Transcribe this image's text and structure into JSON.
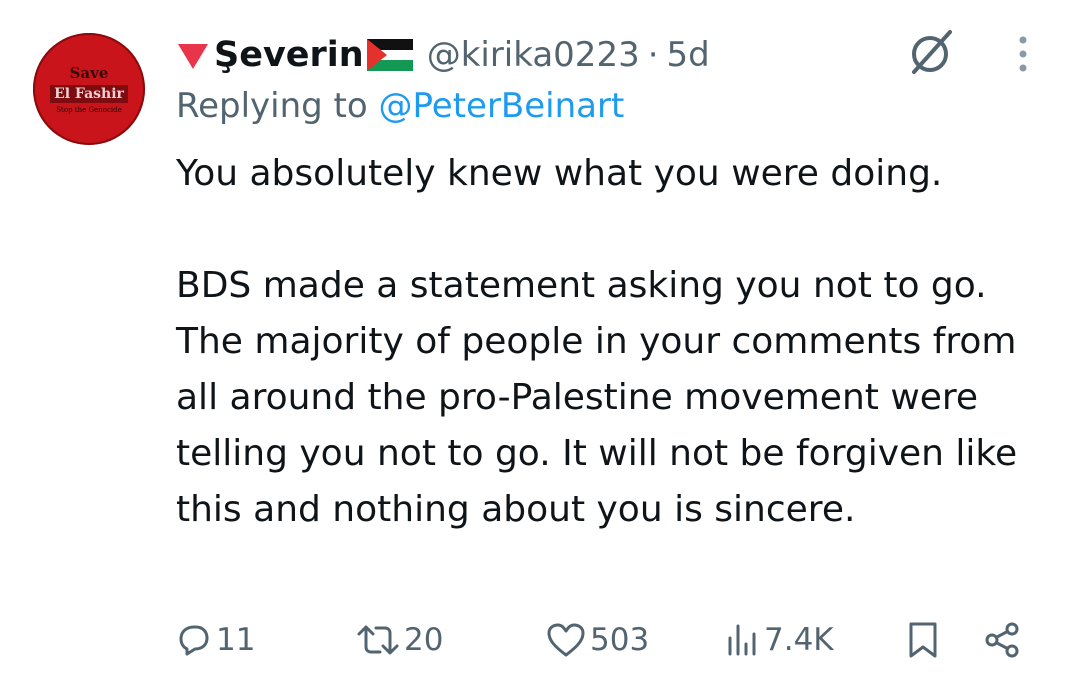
{
  "avatar": {
    "line1": "Save",
    "line2": "El Fashir",
    "line3": "Stop the Genocide",
    "color": "#c8141a"
  },
  "author": {
    "name": "Şeverin",
    "handle": "@kirika0223",
    "separator": "·",
    "time": "5d",
    "prefix_icon": "red-triangle-icon",
    "flag_icon": "palestine-flag-icon"
  },
  "reply": {
    "prefix": "Replying to",
    "target": "@PeterBeinart"
  },
  "tweet": {
    "paragraph1": "You absolutely knew what you were doing.",
    "paragraph2": "BDS made a statement asking you not to go. The majority of people in your comments from all around the pro-Palestine movement were telling you not to go. It will not be forgiven like this and nothing about you is sincere."
  },
  "stats": {
    "replies": "11",
    "reposts": "20",
    "likes": "503",
    "views": "7.4K"
  },
  "colors": {
    "text": "#0f1419",
    "muted": "#536471",
    "link": "#1d9bf0",
    "accent_red": "#e0245e"
  }
}
